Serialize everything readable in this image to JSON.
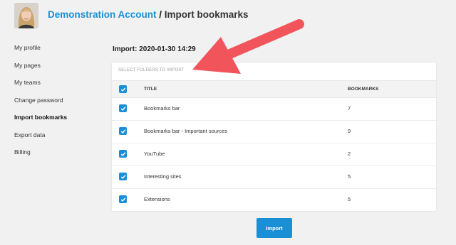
{
  "header": {
    "account_name": "Demonstration Account",
    "separator": " / ",
    "page_name": "Import bookmarks"
  },
  "sidebar": {
    "items": [
      {
        "label": "My profile"
      },
      {
        "label": "My pages"
      },
      {
        "label": "My teams"
      },
      {
        "label": "Change password"
      },
      {
        "label": "Import bookmarks",
        "active": true
      },
      {
        "label": "Export data"
      },
      {
        "label": "Billing"
      }
    ]
  },
  "main": {
    "heading": "Import: 2020-01-30 14:29",
    "card_title": "SELECT FOLDERS TO IMPORT",
    "columns": [
      "TITLE",
      "BOOKMARKS"
    ],
    "rows": [
      {
        "title": "Bookmarks bar",
        "bookmarks": "7",
        "checked": true
      },
      {
        "title": "Bookmarks bar - Important sources",
        "bookmarks": "9",
        "checked": true
      },
      {
        "title": "YouTube",
        "bookmarks": "2",
        "checked": true
      },
      {
        "title": "Interesting sites",
        "bookmarks": "5",
        "checked": true
      },
      {
        "title": "Extensions",
        "bookmarks": "5",
        "checked": true
      }
    ],
    "select_all_checked": true,
    "import_button": "Import"
  },
  "colors": {
    "accent": "#1a8fd6",
    "annotation_arrow": "#f2545b",
    "background": "#f1f1f1"
  },
  "icons": {
    "checkbox": "check-icon",
    "annotation": "red-arrow-icon"
  }
}
